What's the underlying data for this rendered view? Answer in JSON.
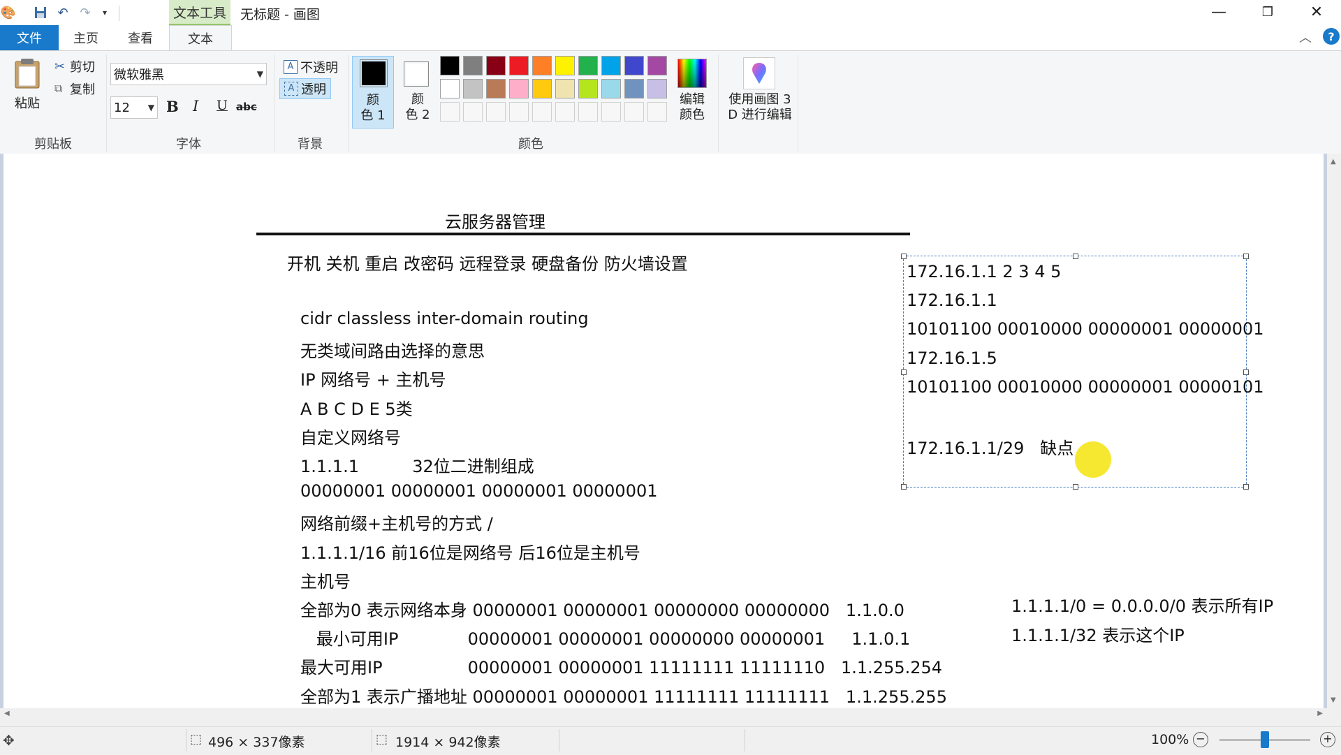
{
  "window": {
    "title": "无标题 - 画图",
    "context_tab": "文本工具",
    "controls": [
      "—",
      "❐",
      "✕"
    ]
  },
  "quick_access": [
    "paint-app-icon",
    "save-icon",
    "undo-icon",
    "redo-icon",
    "customize-qat-icon"
  ],
  "tabs": {
    "file": "文件",
    "home": "主页",
    "view": "查看",
    "text": "文本"
  },
  "clipboard": {
    "paste": "粘贴",
    "cut": "剪切",
    "copy": "复制",
    "label": "剪贴板"
  },
  "font": {
    "family": "微软雅黑",
    "size": "12",
    "bold": "B",
    "italic": "I",
    "underline": "U",
    "strike": "abc",
    "label": "字体"
  },
  "background": {
    "opaque": "不透明",
    "transparent": "透明",
    "label": "背景"
  },
  "colors": {
    "color1_line1": "颜",
    "color1_line2": "色 1",
    "color2_line1": "颜",
    "color2_line2": "色 2",
    "color1_value": "#000000",
    "color2_value": "#ffffff",
    "edit_line1": "编辑",
    "edit_line2": "颜色",
    "label": "颜色",
    "palette_row1": [
      "#000000",
      "#7f7f7f",
      "#880015",
      "#ed1c24",
      "#ff7f27",
      "#fff200",
      "#22b14c",
      "#00a2e8",
      "#3f48cc",
      "#a349a4"
    ],
    "palette_row2": [
      "#ffffff",
      "#c3c3c3",
      "#b97a57",
      "#ffaec9",
      "#ffc90e",
      "#efe4b0",
      "#b5e61d",
      "#99d9ea",
      "#7092be",
      "#c8bfe7"
    ],
    "palette_row3": [
      "",
      "",
      "",
      "",
      "",
      "",
      "",
      "",
      "",
      ""
    ]
  },
  "paint3d": {
    "line1": "使用画图 3",
    "line2": "D 进行编辑"
  },
  "canvas": {
    "heading": "云服务器管理",
    "topics": "开机 关机 重启 改密码 远程登录 硬盘备份 防火墙设置",
    "lines": [
      "cidr classless inter-domain routing",
      "无类域间路由选择的意思",
      "IP 网络号 + 主机号",
      "A B C D E 5类",
      "自定义网络号",
      "1.1.1.1          32位二进制组成",
      "00000001 00000001 00000001 00000001",
      "网络前缀+主机号的方式 /",
      "1.1.1.1/16 前16位是网络号 后16位是主机号",
      "主机号",
      "全部为0 表示网络本身 00000001 00000001 00000000 00000000   1.1.0.0",
      "   最小可用IP             00000001 00000001 00000000 00000001     1.1.0.1",
      "最大可用IP                00000001 00000001 11111111 11111110   1.1.255.254",
      "全部为1 表示广播地址 00000001 00000001 11111111 11111111   1.1.255.255"
    ],
    "right_notes": [
      "1.1.1.1/0 = 0.0.0.0/0 表示所有IP",
      "1.1.1.1/32 表示这个IP"
    ],
    "textbox_lines": [
      "172.16.1.1 2 3 4 5",
      "172.16.1.1",
      "10101100 00010000 00000001 00000001",
      "172.16.1.5",
      "10101100 00010000 00000001 00000101",
      "",
      "172.16.1.1/29   缺点"
    ],
    "cursor_highlight_color": "#f5e61b"
  },
  "status": {
    "selection_size": "496 × 337像素",
    "image_size": "1914 × 942像素",
    "zoom": "100%",
    "zoom_fraction": 0.5
  }
}
